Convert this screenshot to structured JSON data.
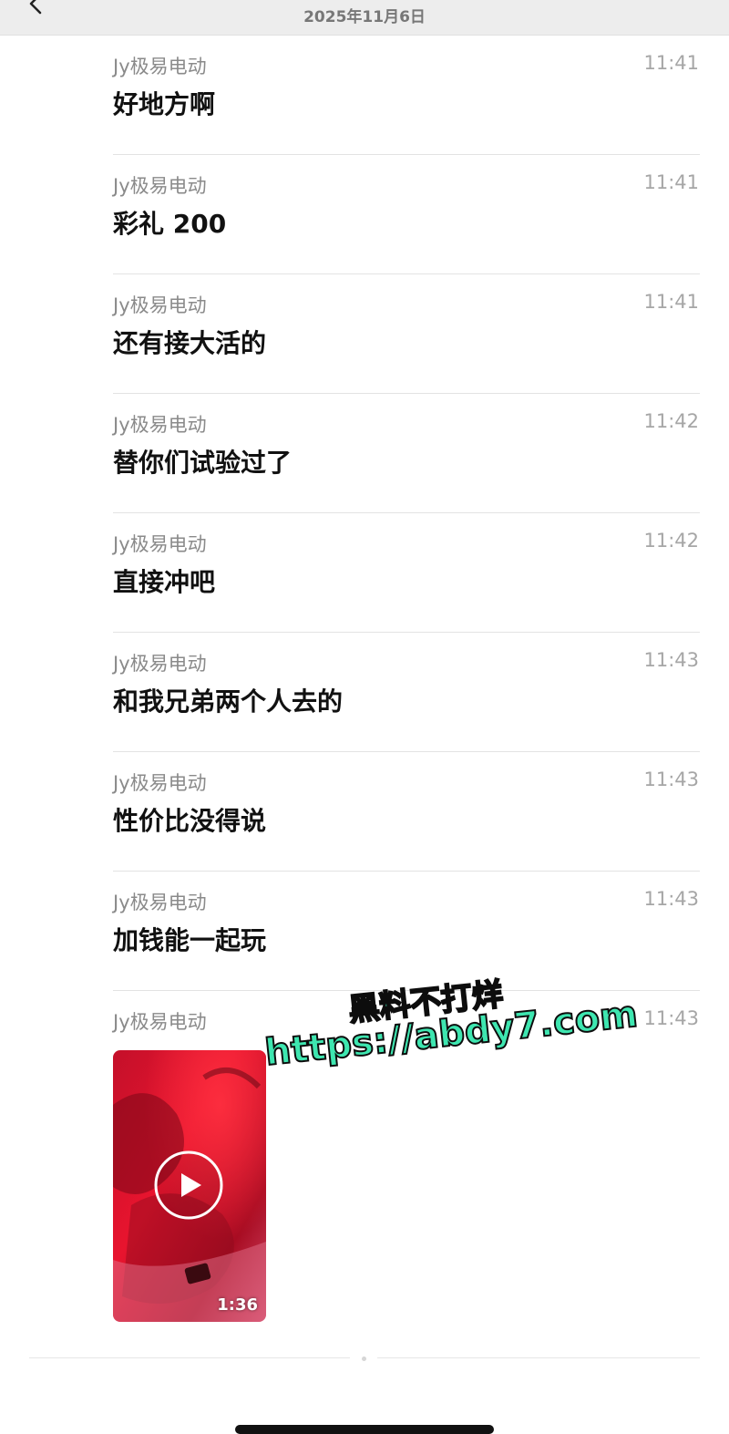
{
  "header": {
    "date": "2025年11月6日"
  },
  "messages": [
    {
      "sender": "Jy极易电动",
      "time": "11:41",
      "text": "好地方啊"
    },
    {
      "sender": "Jy极易电动",
      "time": "11:41",
      "text": "彩礼 200"
    },
    {
      "sender": "Jy极易电动",
      "time": "11:41",
      "text": "还有接大活的"
    },
    {
      "sender": "Jy极易电动",
      "time": "11:42",
      "text": "替你们试验过了"
    },
    {
      "sender": "Jy极易电动",
      "time": "11:42",
      "text": "直接冲吧"
    },
    {
      "sender": "Jy极易电动",
      "time": "11:43",
      "text": "和我兄弟两个人去的"
    },
    {
      "sender": "Jy极易电动",
      "time": "11:43",
      "text": "性价比没得说"
    },
    {
      "sender": "Jy极易电动",
      "time": "11:43",
      "text": "加钱能一起玩"
    }
  ],
  "video_message": {
    "sender": "Jy极易电动",
    "time": "11:43",
    "duration": "1:36"
  },
  "watermark": {
    "line1": "黑料不打烊",
    "line2": "https://abdy7.com"
  },
  "icons": {
    "back": "chevron-left-icon",
    "play": "play-icon"
  },
  "colors": {
    "header_bg": "#ededed",
    "sender": "#8a8a8a",
    "time": "#a6a6a6",
    "watermark": "#3ee6b0"
  }
}
